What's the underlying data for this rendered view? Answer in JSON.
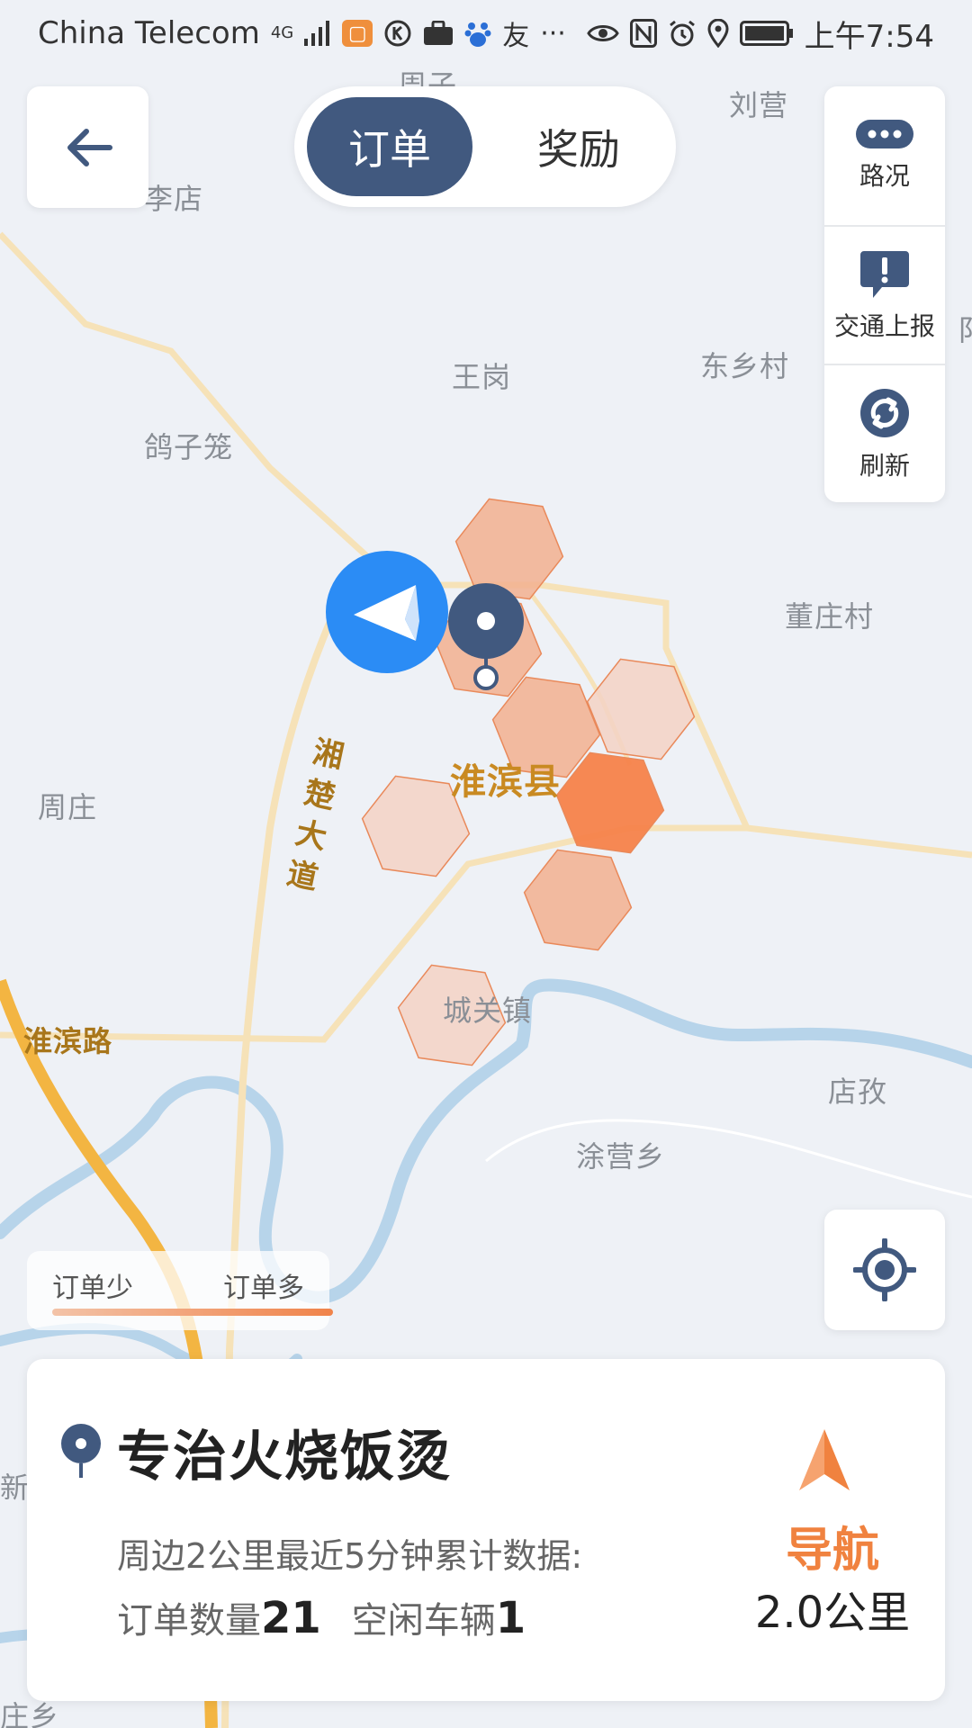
{
  "status_bar": {
    "carrier": "China Telecom",
    "signal": "4G",
    "time": "上午7:54"
  },
  "header": {
    "back_icon": "arrow-left-icon",
    "tabs": [
      {
        "label": "订单",
        "selected": true
      },
      {
        "label": "奖励",
        "selected": false
      }
    ]
  },
  "tools": {
    "traffic_label": "路况",
    "report_label": "交通上报",
    "refresh_label": "刷新"
  },
  "map": {
    "labels": {
      "zhouzi": "周子",
      "liying": "刘营",
      "lidian": "李店",
      "wanggang": "王岗",
      "dongxiangcun": "东乡村",
      "gezilong": "鸽子笼",
      "dongzhuangcun": "董庄村",
      "zhouzhuang": "周庄",
      "county": "淮滨县",
      "huaibin_road": "淮滨路",
      "xiangchu_avenue": "湘楚大道",
      "chengguan": "城关镇",
      "dianzi": "店孜",
      "tuyingxiang": "涂营乡",
      "edge_left_1": "新",
      "edge_left_2": "庄乡",
      "edge_right_1": "阝"
    },
    "heat_colors": {
      "low": "#f3d2c4",
      "mid": "#f2b08f",
      "high": "#f5824a"
    }
  },
  "legend": {
    "low_label": "订单少",
    "high_label": "订单多"
  },
  "info_card": {
    "place_name": "专治火烧饭烫",
    "stats_description": "周边2公里最近5分钟累计数据:",
    "orders_label": "订单数量",
    "orders_count": "21",
    "idle_label": "空闲车辆",
    "idle_count": "1",
    "nav_label": "导航",
    "distance": "2.0公里"
  },
  "colors": {
    "accent_blue": "#41597f",
    "location_blue": "#2b8cf5",
    "nav_orange": "#f0823f"
  }
}
